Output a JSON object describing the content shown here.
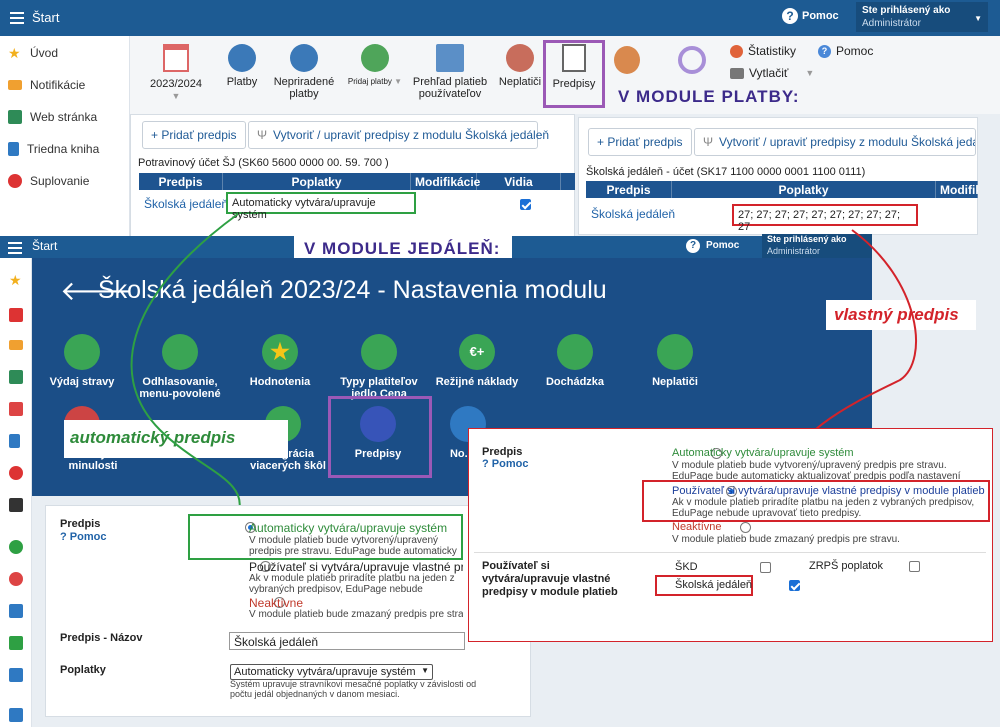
{
  "top": {
    "title": "Štart",
    "help": "Pomoc",
    "user_label": "Ste prihlásený ako",
    "user_role": "Administrátor"
  },
  "sidebar": {
    "items": [
      {
        "label": "Úvod",
        "icon": "star-icon",
        "color": "#f2b01e"
      },
      {
        "label": "Notifikácie",
        "icon": "envelope-icon",
        "color": "#f0a030"
      },
      {
        "label": "Web stránka",
        "icon": "home-icon",
        "color": "#2e8b57"
      },
      {
        "label": "Triedna kniha",
        "icon": "book-icon",
        "color": "#2f79c2"
      },
      {
        "label": "Suplovanie",
        "icon": "person-icon",
        "color": "#d33"
      }
    ]
  },
  "toolbar": {
    "year": "2023/2024",
    "platby": "Platby",
    "nepriradene": "Nepriradené platby",
    "pridaj": "Pridaj platby",
    "prehlad": "Prehľad platieb používateľov",
    "neplatici": "Neplatiči",
    "predpisy": "Predpisy",
    "statistiky": "Štatistiky",
    "vytlacit": "Vytlačiť",
    "pomoc": "Pomoc"
  },
  "labels": {
    "modul_platby": "V  MODULE  PLATBY:",
    "modul_jedalen": "V  MODULE  JEDÁLEŇ:",
    "vlastny": "vlastný predpis",
    "automaticky": "automatický   predpis"
  },
  "left_table": {
    "add": "+ Pridať predpis",
    "create": "Vytvoriť / upraviť predpisy z modulu Školská jedáleň",
    "account": "Potravinový účet ŠJ (SK60 5600 0000 00.  59.  700 )",
    "headers": [
      "Predpis",
      "Poplatky",
      "Modifikácie",
      "Vidia platitelia"
    ],
    "row_name": "Školská jedáleň",
    "row_fee": "Automaticky vytvára/upravuje systém"
  },
  "right_table": {
    "add": "+ Pridať predpis",
    "create": "Vytvoriť / upraviť predpisy z modulu Školská jedáleň",
    "account": "Školská jedáleň - účet (SK17 1100 0000 0001 1100 0111)",
    "headers": [
      "Predpis",
      "Poplatky",
      "Modifik"
    ],
    "row_name": "Školská jedáleň",
    "row_fee": "27; 27; 27; 27; 27; 27; 27; 27; 27; 27"
  },
  "jedalen": {
    "title": "Štart",
    "help": "Pomoc",
    "user_label": "Ste prihlásený ako",
    "user_role": "Administrátor",
    "heading": "Školská jedáleň  2023/24 - Nastavenia modulu",
    "items": [
      "Výdaj stravy",
      "Odhlasovanie, menu-povolené",
      "Hodnotenia",
      "Typy platiteľov jedlo Cena",
      "Režijné náklady",
      "Dochádzka",
      "Neplatiči"
    ],
    "items2": [
      "Zmeny z minulosti",
      "integrácia viacerých škôl",
      "Predpisy",
      "No... ..."
    ]
  },
  "form_left": {
    "predpis": "Predpis",
    "pomoc": "? Pomoc",
    "opt1": "Automaticky vytvára/upravuje systém",
    "opt1_desc": "V module platieb bude vytvorený/upravený predpis pre stravu. EduPage bude automaticky aktualizovať predpis",
    "opt2": "Používateľ si vytvára/upravuje vlastné predpisy",
    "opt2_desc": "Ak v module platieb priradíte platbu na jeden z vybraných predpisov, EduPage nebude upravovať tieto predpisy.",
    "opt3": "Neaktívne",
    "opt3_desc": "V module platieb bude zmazaný predpis pre stravu.",
    "name_label": "Predpis - Názov",
    "name_value": "Školská jedáleň",
    "fees_label": "Poplatky",
    "fees_value": "Automaticky vytvára/upravuje systém",
    "fees_desc": "Systém upravuje stravníkovi mesačné poplatky v závislosti od počtu jedál objednaných v danom mesiaci."
  },
  "form_right": {
    "predpis": "Predpis",
    "pomoc": "? Pomoc",
    "opt1": "Automaticky vytvára/upravuje systém",
    "opt1_desc": "V module platieb bude vytvorený/upravený predpis pre stravu. EduPage bude automaticky aktualizovať predpis podľa nastavení nižšie.",
    "opt2": "Používateľ si vytvára/upravuje vlastné predpisy v module platieb",
    "opt2_desc": "Ak v module platieb priradíte platbu na jeden z vybraných predpisov, EduPage nebude upravovať tieto predpisy.",
    "opt3": "Neaktívne",
    "opt3_desc": "V module platieb bude zmazaný predpis pre stravu.",
    "own_label": "Používateľ si vytvára/upravuje vlastné predpisy v module platieb",
    "skd": "ŠKD",
    "zrps": "ZRPŠ poplatok",
    "sj": "Školská jedáleň"
  }
}
